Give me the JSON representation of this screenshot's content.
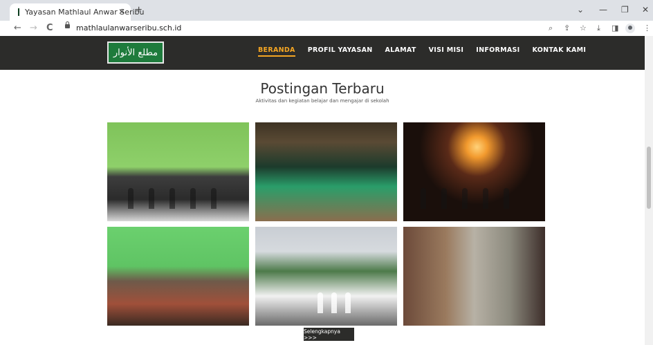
{
  "browser": {
    "tab_title": "Yayasan Mathlaul Anwar Seribu",
    "tab_close": "✕",
    "new_tab": "+",
    "url": "mathlaulanwarseribu.sch.id",
    "window_controls": {
      "dropdown": "⌄",
      "minimize": "—",
      "restore": "❐",
      "close": "✕"
    },
    "nav_icons": {
      "back": "←",
      "forward": "→",
      "reload": "C"
    },
    "toolbar_icons": {
      "zoom": "⌕",
      "share": "⇪",
      "bookmark": "☆",
      "download": "⤓",
      "sidepanel": "◨",
      "menu": "⋮"
    }
  },
  "site": {
    "logo_text": "مطلع الأنوار",
    "menu": [
      {
        "label": "BERANDA",
        "active": true
      },
      {
        "label": "PROFIL YAYASAN",
        "active": false
      },
      {
        "label": "ALAMAT",
        "active": false
      },
      {
        "label": "VISI MISI",
        "active": false
      },
      {
        "label": "INFORMASI",
        "active": false
      },
      {
        "label": "KONTAK KAMI",
        "active": false
      }
    ],
    "accent_color": "#f5a623",
    "header_color": "#2c2c2a"
  },
  "section": {
    "title": "Postingan Terbaru",
    "subtitle": "Aktivitas dan kegiatan belajar dan mengajar di sekolah",
    "more_button": "Selengkapnya >>>"
  }
}
